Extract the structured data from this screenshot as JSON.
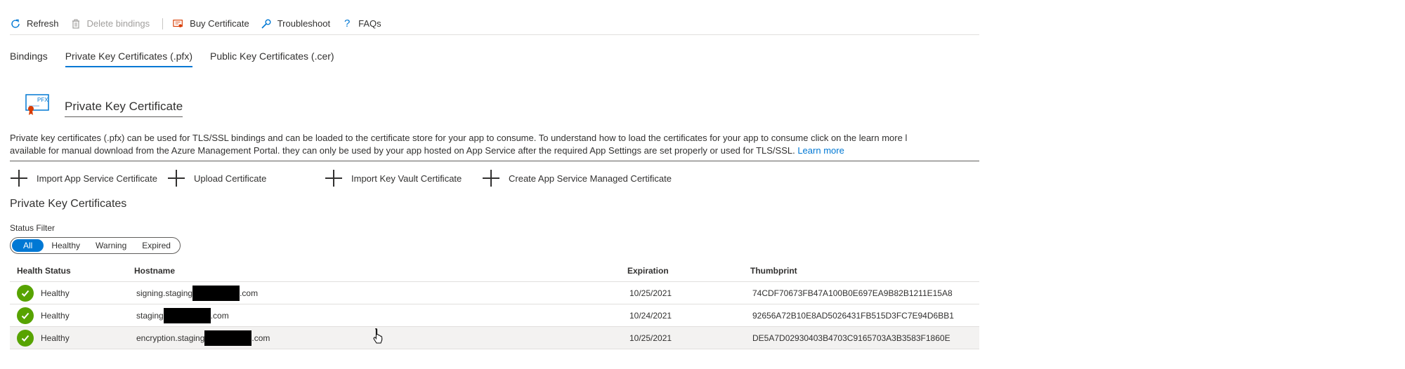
{
  "toolbar": {
    "refresh": "Refresh",
    "delete_bindings": "Delete bindings",
    "buy_certificate": "Buy Certificate",
    "troubleshoot": "Troubleshoot",
    "faqs": "FAQs"
  },
  "tabs": [
    {
      "label": "Bindings"
    },
    {
      "label": "Private Key Certificates (.pfx)"
    },
    {
      "label": "Public Key Certificates (.cer)"
    }
  ],
  "section": {
    "icon_text": "PFX",
    "title": "Private Key Certificate"
  },
  "description": {
    "line1": "Private key certificates (.pfx) can be used for TLS/SSL bindings and can be loaded to the certificate store for your app to consume. To understand how to load the certificates for your app to consume click on the learn more l",
    "line2": "available for manual download from the Azure Management Portal. they can only be used by your app hosted on App Service after the required App Settings are set properly or used for TLS/SSL.",
    "learn_more": "Learn more"
  },
  "actions": [
    {
      "label": "Import App Service Certificate"
    },
    {
      "label": "Upload Certificate"
    },
    {
      "label": "Import Key Vault Certificate"
    },
    {
      "label": "Create App Service Managed Certificate"
    }
  ],
  "list": {
    "title": "Private Key Certificates",
    "filter_label": "Status Filter",
    "filters": [
      "All",
      "Healthy",
      "Warning",
      "Expired"
    ],
    "selected_filter": "All",
    "columns": [
      "Health Status",
      "Hostname",
      "Expiration",
      "Thumbprint"
    ],
    "rows": [
      {
        "status": "Healthy",
        "host_prefix": "signing.staging",
        "host_suffix": ".com",
        "expiration": "10/25/2021",
        "thumbprint": "74CDF70673FB47A100B0E697EA9B82B1211E15A8"
      },
      {
        "status": "Healthy",
        "host_prefix": "staging",
        "host_suffix": ".com",
        "expiration": "10/24/2021",
        "thumbprint": "92656A72B10E8AD5026431FB515D3FC7E94D6BB1"
      },
      {
        "status": "Healthy",
        "host_prefix": "encryption.staging",
        "host_suffix": ".com",
        "expiration": "10/25/2021",
        "thumbprint": "DE5A7D02930403B4703C9165703A3B3583F1860E"
      }
    ]
  },
  "colors": {
    "accent": "#0078d4",
    "healthy": "#57a300"
  }
}
